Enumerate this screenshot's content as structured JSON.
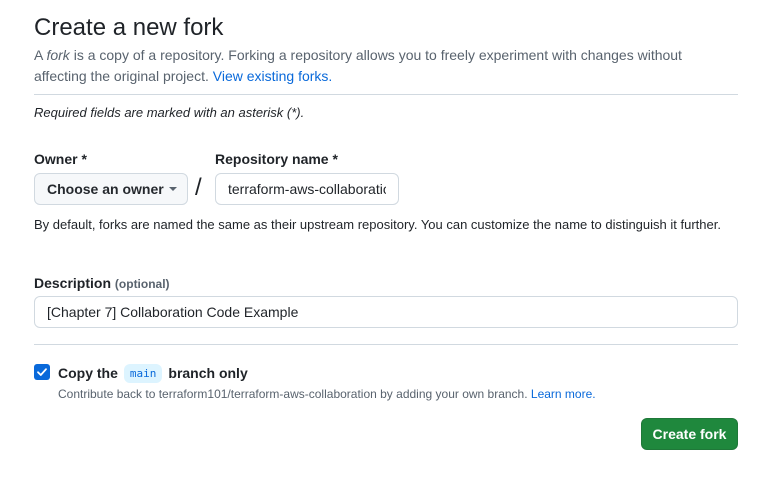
{
  "page": {
    "title": "Create a new fork",
    "intro_prefix": "A ",
    "intro_fork_word": "fork",
    "intro_text": " is a copy of a repository. Forking a repository allows you to freely experiment with changes without affecting the original project. ",
    "intro_link": "View existing forks."
  },
  "form": {
    "required_note": "Required fields are marked with an asterisk (*).",
    "owner": {
      "label": "Owner *",
      "button_label": "Choose an owner"
    },
    "slash": "/",
    "repository": {
      "label": "Repository name *",
      "value": "terraform-aws-collaboration"
    },
    "naming_hint": "By default, forks are named the same as their upstream repository. You can customize the name to distinguish it further.",
    "description": {
      "label": "Description",
      "optional_tag": "(optional)",
      "value": "[Chapter 7] Collaboration Code Example"
    },
    "copy_branch": {
      "checked": true,
      "label_prefix": "Copy the",
      "branch": "main",
      "label_suffix": "branch only",
      "help_text": "Contribute back to terraform101/terraform-aws-collaboration by adding your own branch. ",
      "help_link": "Learn more."
    },
    "submit_label": "Create fork"
  },
  "colors": {
    "primary_button": "#1f883d",
    "link": "#0969da",
    "checkbox": "#0969da"
  }
}
